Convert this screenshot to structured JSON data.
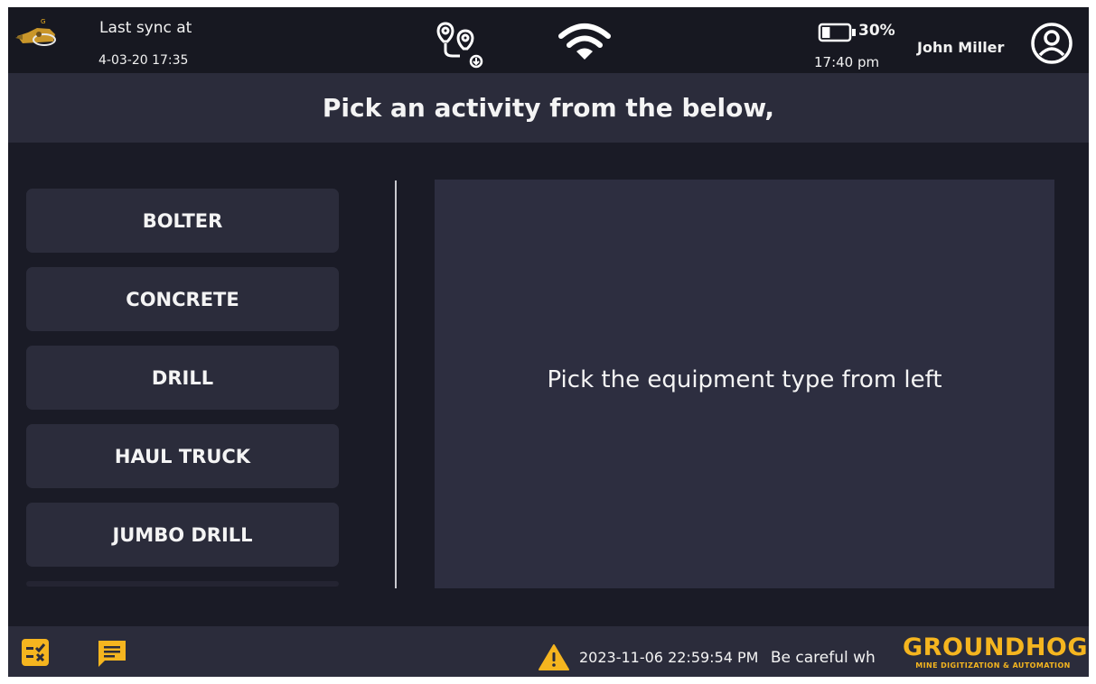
{
  "topbar": {
    "last_sync_label": "Last sync at",
    "last_sync_value": "4-03-20 17:35",
    "battery_percent": "30%",
    "battery_level": 0.3,
    "time": "17:40 pm",
    "user_name": "John Miller",
    "icons": [
      "app-logo-icon",
      "route-icon",
      "wifi-icon",
      "battery-icon",
      "user-avatar-icon"
    ]
  },
  "page": {
    "title": "Pick an activity from the below,"
  },
  "equipment_types": [
    {
      "label": "BOLTER"
    },
    {
      "label": "CONCRETE"
    },
    {
      "label": "DRILL"
    },
    {
      "label": "HAUL TRUCK"
    },
    {
      "label": "JUMBO DRILL"
    }
  ],
  "detail": {
    "placeholder": "Pick the equipment type from left"
  },
  "bottombar": {
    "alert_time": "2023-11-06 22:59:54 PM",
    "alert_message": "Be careful wh",
    "brand_name": "GROUNDHOG",
    "brand_tagline": "MINE DIGITIZATION & AUTOMATION",
    "icons": [
      "checklist-icon",
      "chat-icon",
      "warning-icon"
    ]
  },
  "colors": {
    "background": "#1a1b26",
    "panel": "#2b2c3b",
    "accent": "#f5b51f"
  }
}
